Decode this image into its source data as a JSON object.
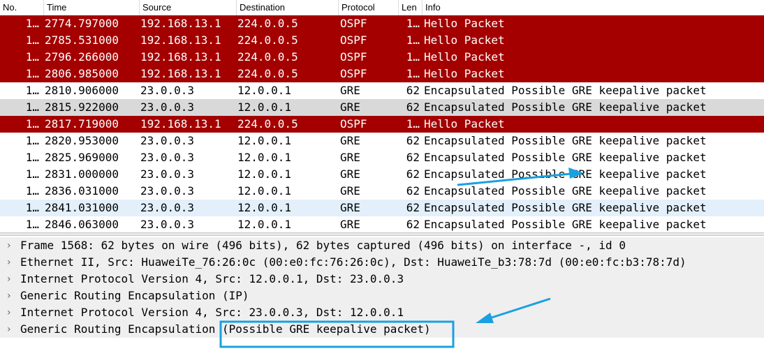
{
  "columns": [
    "No.",
    "Time",
    "Source",
    "Destination",
    "Protocol",
    "Len",
    "Info"
  ],
  "packets": [
    {
      "no": "1…",
      "time": "2774.797000",
      "src": "192.168.13.1",
      "dst": "224.0.0.5",
      "proto": "OSPF",
      "len": "1…",
      "info": "Hello Packet",
      "style": "ospf"
    },
    {
      "no": "1…",
      "time": "2785.531000",
      "src": "192.168.13.1",
      "dst": "224.0.0.5",
      "proto": "OSPF",
      "len": "1…",
      "info": "Hello Packet",
      "style": "ospf"
    },
    {
      "no": "1…",
      "time": "2796.266000",
      "src": "192.168.13.1",
      "dst": "224.0.0.5",
      "proto": "OSPF",
      "len": "1…",
      "info": "Hello Packet",
      "style": "ospf"
    },
    {
      "no": "1…",
      "time": "2806.985000",
      "src": "192.168.13.1",
      "dst": "224.0.0.5",
      "proto": "OSPF",
      "len": "1…",
      "info": "Hello Packet",
      "style": "ospf"
    },
    {
      "no": "1…",
      "time": "2810.906000",
      "src": "23.0.0.3",
      "dst": "12.0.0.1",
      "proto": "GRE",
      "len": "62",
      "info": "Encapsulated Possible GRE keepalive packet",
      "style": "gre"
    },
    {
      "no": "1…",
      "time": "2815.922000",
      "src": "23.0.0.3",
      "dst": "12.0.0.1",
      "proto": "GRE",
      "len": "62",
      "info": "Encapsulated Possible GRE keepalive packet",
      "style": "gre-gray"
    },
    {
      "no": "1…",
      "time": "2817.719000",
      "src": "192.168.13.1",
      "dst": "224.0.0.5",
      "proto": "OSPF",
      "len": "1…",
      "info": "Hello Packet",
      "style": "ospf"
    },
    {
      "no": "1…",
      "time": "2820.953000",
      "src": "23.0.0.3",
      "dst": "12.0.0.1",
      "proto": "GRE",
      "len": "62",
      "info": "Encapsulated Possible GRE keepalive packet",
      "style": "gre"
    },
    {
      "no": "1…",
      "time": "2825.969000",
      "src": "23.0.0.3",
      "dst": "12.0.0.1",
      "proto": "GRE",
      "len": "62",
      "info": "Encapsulated Possible GRE keepalive packet",
      "style": "gre"
    },
    {
      "no": "1…",
      "time": "2831.000000",
      "src": "23.0.0.3",
      "dst": "12.0.0.1",
      "proto": "GRE",
      "len": "62",
      "info": "Encapsulated Possible GRE keepalive packet",
      "style": "gre"
    },
    {
      "no": "1…",
      "time": "2836.031000",
      "src": "23.0.0.3",
      "dst": "12.0.0.1",
      "proto": "GRE",
      "len": "62",
      "info": "Encapsulated Possible GRE keepalive packet",
      "style": "gre"
    },
    {
      "no": "1…",
      "time": "2841.031000",
      "src": "23.0.0.3",
      "dst": "12.0.0.1",
      "proto": "GRE",
      "len": "62",
      "info": "Encapsulated Possible GRE keepalive packet",
      "style": "gre-sel"
    },
    {
      "no": "1…",
      "time": "2846.063000",
      "src": "23.0.0.3",
      "dst": "12.0.0.1",
      "proto": "GRE",
      "len": "62",
      "info": "Encapsulated Possible GRE keepalive packet",
      "style": "gre"
    }
  ],
  "details": [
    "Frame 1568: 62 bytes on wire (496 bits), 62 bytes captured (496 bits) on interface -, id 0",
    "Ethernet II, Src: HuaweiTe_76:26:0c (00:e0:fc:76:26:0c), Dst: HuaweiTe_b3:78:7d (00:e0:fc:b3:78:7d)",
    "Internet Protocol Version 4, Src: 12.0.0.1, Dst: 23.0.0.3",
    "Generic Routing Encapsulation (IP)",
    "Internet Protocol Version 4, Src: 23.0.0.3, Dst: 12.0.0.1",
    "Generic Routing Encapsulation (Possible GRE keepalive packet)"
  ],
  "icons": {
    "expand": "chevron-right-icon",
    "annotation_arrow": "arrow-icon"
  },
  "colors": {
    "ospf_row": "#a40000",
    "annotation": "#1aa0e0",
    "selected_row": "#e3f0fb"
  }
}
